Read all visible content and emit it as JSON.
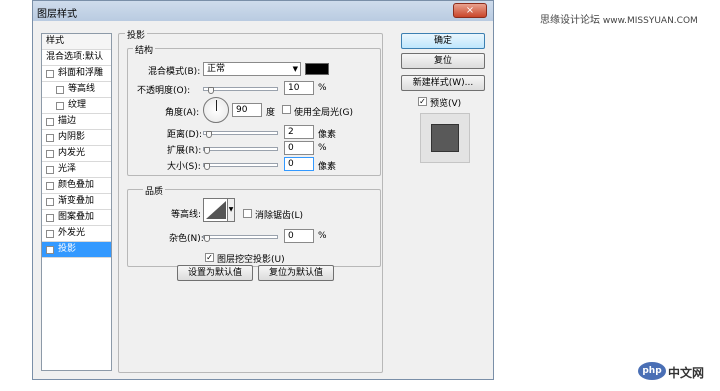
{
  "window": {
    "title": "图层样式",
    "close": "×"
  },
  "watermark": {
    "site_cn": "思缘设计论坛",
    "site_url": "www.MISSYUAN.COM",
    "logo_php": "php",
    "logo_text": "中文网"
  },
  "stylelist": {
    "header": "样式",
    "blend_default": "混合选项:默认",
    "items": [
      {
        "label": "斜面和浮雕",
        "checked": false
      },
      {
        "label": "等高线",
        "checked": false
      },
      {
        "label": "纹理",
        "checked": false
      },
      {
        "label": "描边",
        "checked": false
      },
      {
        "label": "内阴影",
        "checked": false
      },
      {
        "label": "内发光",
        "checked": false
      },
      {
        "label": "光泽",
        "checked": false
      },
      {
        "label": "颜色叠加",
        "checked": false
      },
      {
        "label": "渐变叠加",
        "checked": false
      },
      {
        "label": "图案叠加",
        "checked": false
      },
      {
        "label": "外发光",
        "checked": false
      },
      {
        "label": "投影",
        "checked": true
      }
    ]
  },
  "dropshadow": {
    "title": "投影",
    "structure": {
      "title": "结构",
      "blend_mode_label": "混合模式(B):",
      "blend_mode_value": "正常",
      "blend_color": "#000000",
      "opacity_label": "不透明度(O):",
      "opacity_value": "10",
      "opacity_unit": "%",
      "angle_label": "角度(A):",
      "angle_value": "90",
      "angle_unit": "度",
      "global_light_label": "使用全局光(G)",
      "global_light_checked": false,
      "distance_label": "距离(D):",
      "distance_value": "2",
      "distance_unit": "像素",
      "spread_label": "扩展(R):",
      "spread_value": "0",
      "spread_unit": "%",
      "size_label": "大小(S):",
      "size_value": "0",
      "size_unit": "像素"
    },
    "quality": {
      "title": "品质",
      "contour_label": "等高线:",
      "antialias_label": "消除锯齿(L)",
      "antialias_checked": false,
      "noise_label": "杂色(N):",
      "noise_value": "0",
      "noise_unit": "%"
    },
    "knockout_label": "图层挖空投影(U)",
    "knockout_checked": true,
    "make_default": "设置为默认值",
    "reset_default": "复位为默认值"
  },
  "buttons": {
    "ok": "确定",
    "reset": "复位",
    "new_style": "新建样式(W)...",
    "preview_label": "预览(V)",
    "preview_checked": true
  },
  "check_mark": "✓"
}
